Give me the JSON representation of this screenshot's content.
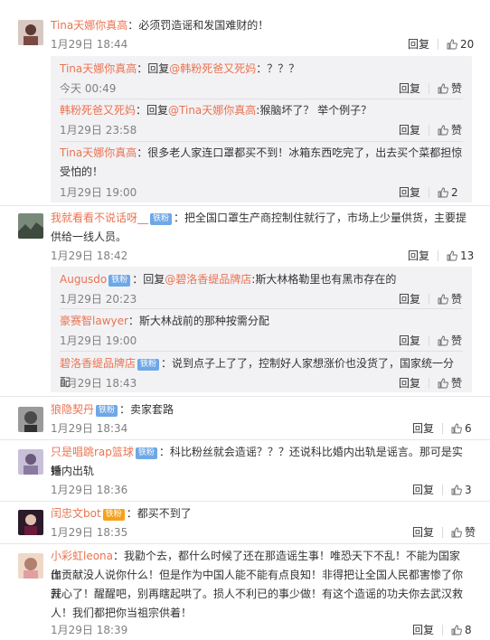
{
  "labels": {
    "reply": "回复",
    "like": "赞"
  },
  "comments": [
    {
      "user": "Tina天娜你真高",
      "text": "：必须罚造谣和发国难财的！",
      "time": "1月29日 18:44",
      "likes": "20",
      "replies": [
        {
          "user": "Tina天娜你真高",
          "mid": "：回复",
          "at": "@韩粉死爸又死妈",
          "text": "：？？？",
          "time": "今天 00:49"
        },
        {
          "user": "韩粉死爸又死妈",
          "mid": "：回复",
          "at": "@Tina天娜你真高",
          "text": ":猴脑坏了？ 举个例子？",
          "time": "1月29日 23:58"
        },
        {
          "user": "Tina天娜你真高",
          "text1": "：很多老人家连口罩都买不到！冰箱东西吃完了，出去买个菜都担惊",
          "text2": "受怕的！",
          "time": "1月29日 19:00",
          "likes": "2"
        }
      ]
    },
    {
      "user": "我就看看不说话呀__",
      "badge": "铁粉",
      "text1": "：把全国口罩生产商控制住就行了，市场上少量供货，主要提",
      "text2": "供给一线人员。",
      "time": "1月29日 18:42",
      "likes": "13",
      "replies": [
        {
          "user": "Augusdo",
          "badge": "铁粉",
          "mid": "：回复",
          "at": "@碧洛香缇品牌店",
          "text": ":斯大林格勒里也有黑市存在的",
          "time": "1月29日 20:23"
        },
        {
          "user": "豪赛智lawyer",
          "text": "：斯大林战前的那种按需分配",
          "time": "1月29日 19:00"
        },
        {
          "user": "碧洛香缇品牌店",
          "badge": "铁粉",
          "text": "：说到点子上了了，控制好人家想涨价也没货了，国家统一分配",
          "time": "1月29日 18:43"
        }
      ]
    },
    {
      "user": "狼隐契丹",
      "badge": "铁粉",
      "text": "：卖家套路",
      "time": "1月29日 18:34",
      "likes": "6"
    },
    {
      "user": "只是唱跳rap篮球",
      "badge": "铁粉",
      "text1": "：科比粉丝就会造谣？？？还说科比婚内出轨是谣言。那可是实锤",
      "text2": "婚内出轨",
      "time": "1月29日 18:36",
      "likes": "3"
    },
    {
      "user": "闰忠文bot",
      "vip": "铁粉",
      "text": "：都买不到了",
      "time": "1月29日 18:35"
    },
    {
      "user": "小彩虹leona",
      "text1": "：我勸个去，都什么时候了还在那造谣生事！唯恐天下不乱！不能为国家作",
      "text2": "出贡献没人说你什么！但是作为中国人能不能有点良知！非得把让全国人民都害惨了你就",
      "text3": "开心了！醒醒吧，别再瞎起哄了。损人不利已的事少做！有这个造谣的功夫你去武汉救",
      "text4": "人！我们都把你当祖宗供着！",
      "time": "1月29日 18:39",
      "likes": "8"
    }
  ]
}
